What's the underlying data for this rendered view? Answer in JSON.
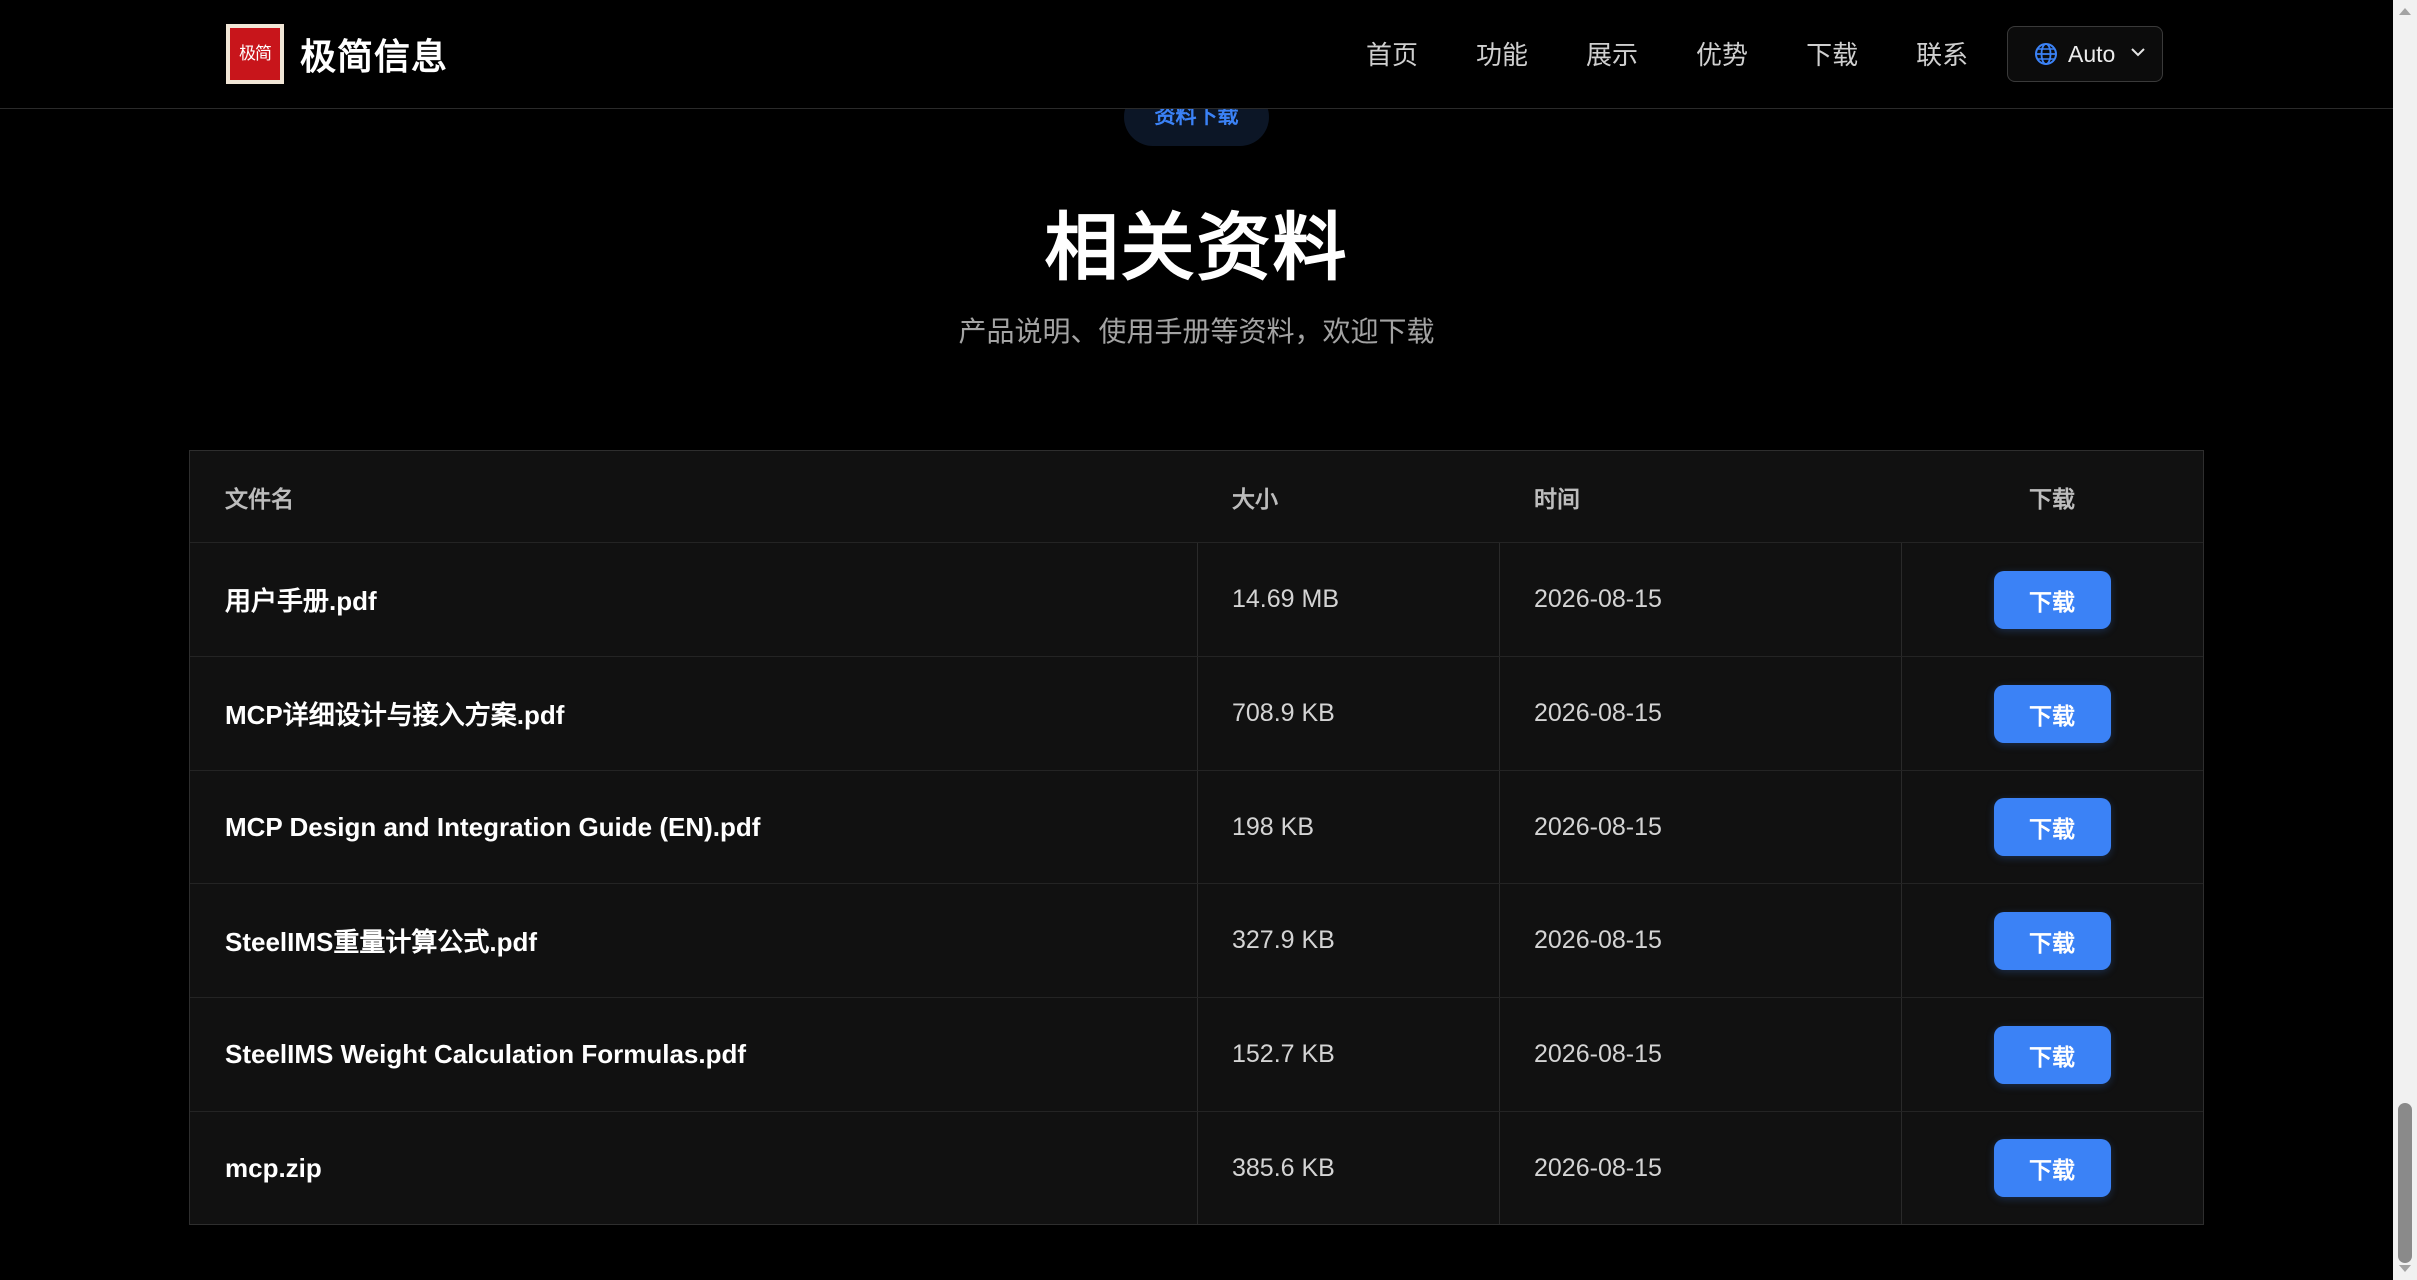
{
  "nav": {
    "logo_text": "极简",
    "brand": "极简信息",
    "links": [
      "首页",
      "功能",
      "展示",
      "优势",
      "下载",
      "联系"
    ],
    "lang_label": "Auto"
  },
  "section": {
    "tag": "资料下载",
    "title": "相关资料",
    "subtitle": "产品说明、使用手册等资料，欢迎下载"
  },
  "table": {
    "headers": [
      "文件名",
      "大小",
      "时间",
      "下载"
    ],
    "rows": [
      {
        "name": "用户手册.pdf",
        "size": "14.69 MB",
        "date": "2026-08-15",
        "action": "下载"
      },
      {
        "name": "MCP详细设计与接入方案.pdf",
        "size": "708.9 KB",
        "date": "2026-08-15",
        "action": "下载"
      },
      {
        "name": "MCP Design and Integration Guide (EN).pdf",
        "size": "198 KB",
        "date": "2026-08-15",
        "action": "下载"
      },
      {
        "name": "SteelIMS重量计算公式.pdf",
        "size": "327.9 KB",
        "date": "2026-08-15",
        "action": "下载"
      },
      {
        "name": "SteelIMS Weight Calculation Formulas.pdf",
        "size": "152.7 KB",
        "date": "2026-08-15",
        "action": "下载"
      },
      {
        "name": "mcp.zip",
        "size": "385.6 KB",
        "date": "2026-08-15",
        "action": "下载"
      }
    ]
  },
  "colors": {
    "accent": "#3b82f6",
    "background": "#000000",
    "table_bg": "#111111",
    "logo_red": "#c8151b"
  },
  "icons": {
    "language": "globe-icon",
    "dropdown": "chevron-down-icon"
  }
}
